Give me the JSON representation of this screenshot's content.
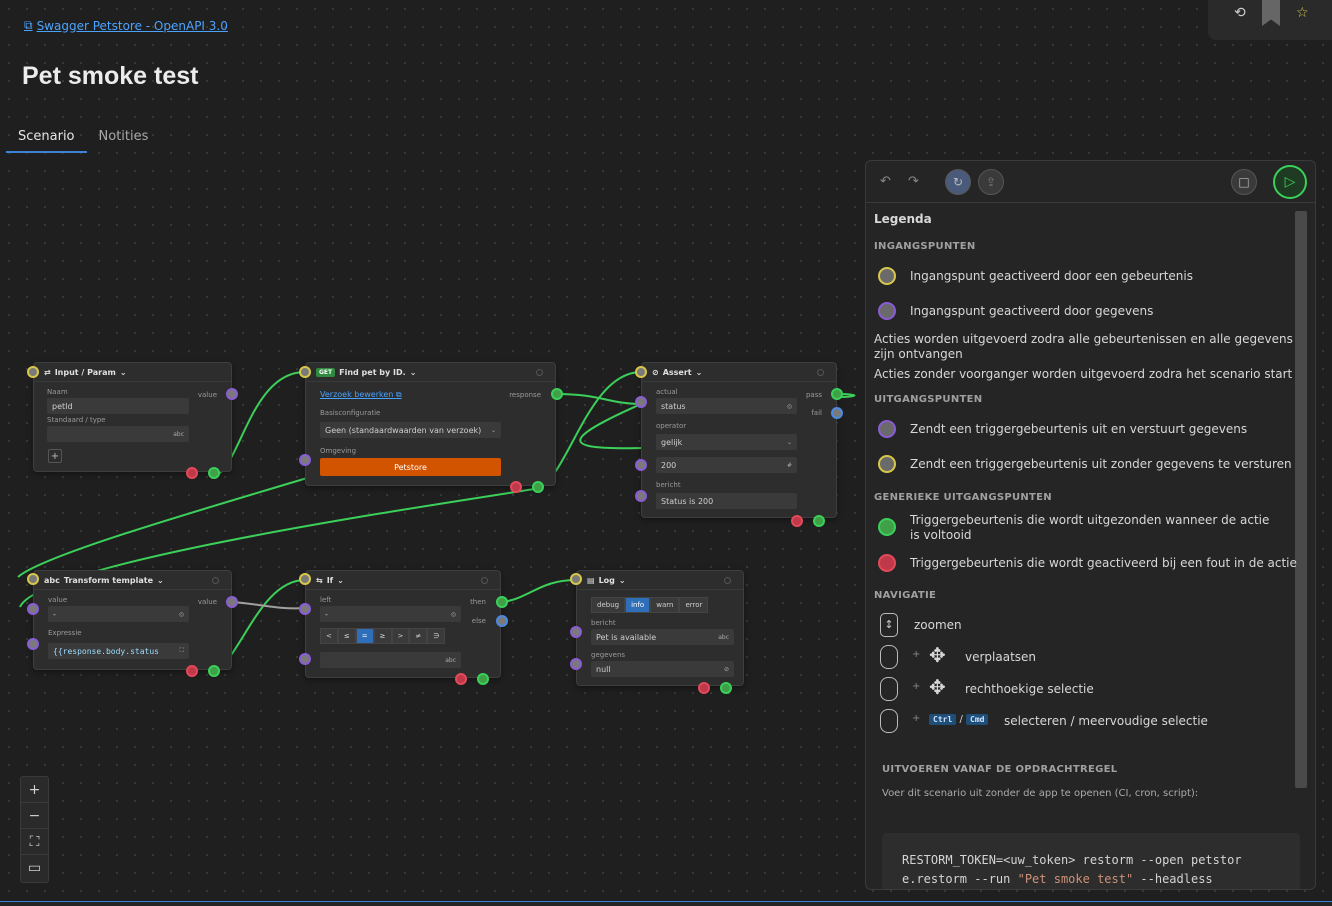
{
  "header": {
    "breadcrumb": "Swagger Petstore - OpenAPI 3.0",
    "title": "Pet smoke test"
  },
  "tabs": [
    {
      "label": "Scenario"
    },
    {
      "label": "Notities"
    }
  ],
  "nodes": {
    "input": {
      "title": "Input / Param",
      "name_label": "Naam",
      "name_value": "petId",
      "default_label": "Standaard / type",
      "type_suffix": "abc",
      "out_label": "value",
      "add_icon": "+"
    },
    "find": {
      "method": "GET",
      "title": "Find pet by ID.",
      "edit_link": "Verzoek bewerken",
      "base_label": "Basisconfiguratie",
      "base_value": "Geen (standaardwaarden van verzoek)",
      "env_label": "Omgeving",
      "env_value": "Petstore",
      "out_label": "response"
    },
    "assert": {
      "title": "Assert",
      "actual_label": "actual",
      "actual_value": "status",
      "operator_label": "operator",
      "operator_value": "gelijk",
      "expected_value": "200",
      "message_label": "bericht",
      "message_value": "Status is 200",
      "pass_label": "pass",
      "fail_label": "fail"
    },
    "transform": {
      "title": "Transform template",
      "value_label": "value",
      "value_value": "-",
      "expr_label": "Expressie",
      "expr_value": "{{response.body.status",
      "out_label": "value"
    },
    "if": {
      "title": "If",
      "left_label": "left",
      "left_value": "-",
      "then_label": "then",
      "else_label": "else",
      "ops": [
        "<",
        "≤",
        "=",
        "≥",
        ">",
        "≠",
        "∋"
      ],
      "active_op": "=",
      "type_suffix": "abc"
    },
    "log": {
      "title": "Log",
      "levels": [
        "debug",
        "info",
        "warn",
        "error"
      ],
      "active_level": "info",
      "message_label": "bericht",
      "message_value": "Pet is available",
      "data_label": "gegevens",
      "data_value": "null",
      "type_suffix": "abc"
    }
  },
  "panel": {
    "legend_title": "Legenda",
    "entry_section": "INGANGSPUNTEN",
    "entry_event": "Ingangspunt geactiveerd door een gebeurtenis",
    "entry_data": "Ingangspunt geactiveerd door gegevens",
    "note1": "Acties worden uitgevoerd zodra alle gebeurtenissen en alle gegevens zijn ontvangen",
    "note2": "Acties zonder voorganger worden uitgevoerd zodra het scenario start",
    "exit_section": "UITGANGSPUNTEN",
    "exit_data": "Zendt een triggergebeurtenis uit en verstuurt gegevens",
    "exit_nodata": "Zendt een triggergebeurtenis uit zonder gegevens te versturen",
    "generic_section": "GENERIEKE UITGANGSPUNTEN",
    "generic_done": "Triggergebeurtenis die wordt uitgezonden wanneer de actie is voltooid",
    "generic_error": "Triggergebeurtenis die wordt geactiveerd bij een fout in de actie",
    "nav_section": "NAVIGATIE",
    "nav_zoom": "zoomen",
    "nav_move": "verplaatsen",
    "nav_rect": "rechthoekige selectie",
    "nav_select": "selecteren / meervoudige selectie",
    "plus": "+",
    "key_ctrl": "Ctrl",
    "key_sep": "/",
    "key_cmd": "Cmd",
    "cli_section": "UITVOEREN VANAF DE OPDRACHTREGEL",
    "cli_desc": "Voer dit scenario uit zonder de app te openen (CI, cron, script):",
    "cli_line1": "RESTORM_TOKEN=<uw_token> restorm --open petstor",
    "cli_line2a": "e.restorm --run ",
    "cli_line2b": "\"Pet smoke test\"",
    "cli_line2c": " --headless"
  },
  "colors": {
    "event": "#d8c84a",
    "data": "#8a5cd6",
    "done": "#3ad05a",
    "error": "#e24a5a",
    "accent": "#3c82d6",
    "env": "#d35400"
  }
}
